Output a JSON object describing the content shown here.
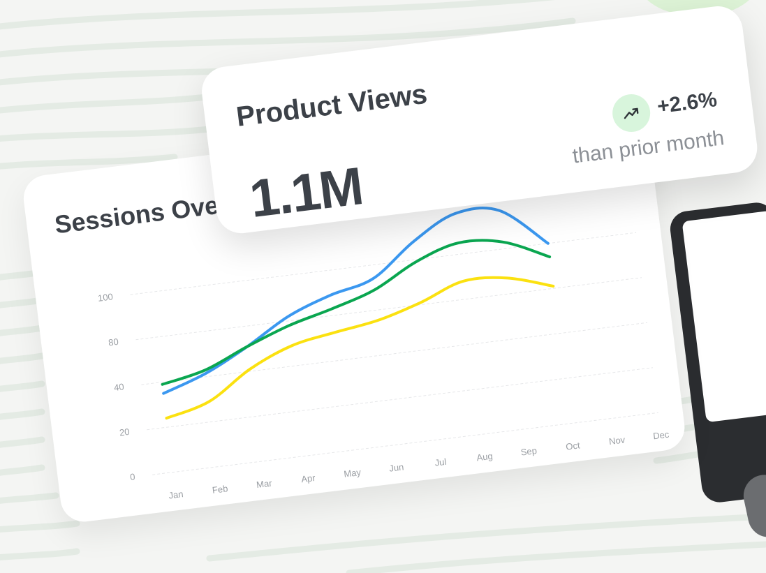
{
  "views_card": {
    "title": "Product Views",
    "value": "1.1M",
    "delta": "+2.6%",
    "comparison": "than prior month",
    "trend_icon": "trending-up-icon",
    "trend_color": "#d8f5dc"
  },
  "sessions_card": {
    "title": "Sessions Ove"
  },
  "chart_data": {
    "type": "line",
    "categories": [
      "Jan",
      "Feb",
      "Mar",
      "Apr",
      "May",
      "Jun",
      "Jul",
      "Aug",
      "Sep",
      "Oct",
      "Nov",
      "Dec"
    ],
    "y_ticks": [
      "0",
      "20",
      "40",
      "80",
      "100"
    ],
    "grid": true,
    "series": [
      {
        "color": "#3b98f0",
        "values": [
          35,
          43,
          62,
          82,
          89,
          94,
          108,
          118,
          117,
          100,
          null,
          null
        ]
      },
      {
        "color": "#0aa650",
        "values": [
          39,
          46,
          62,
          76,
          83,
          89,
          99,
          105,
          103,
          94,
          null,
          null
        ]
      },
      {
        "color": "#fbe110",
        "values": [
          24,
          29,
          42,
          58,
          65,
          71,
          81,
          88,
          87,
          81,
          null,
          null
        ]
      }
    ]
  }
}
